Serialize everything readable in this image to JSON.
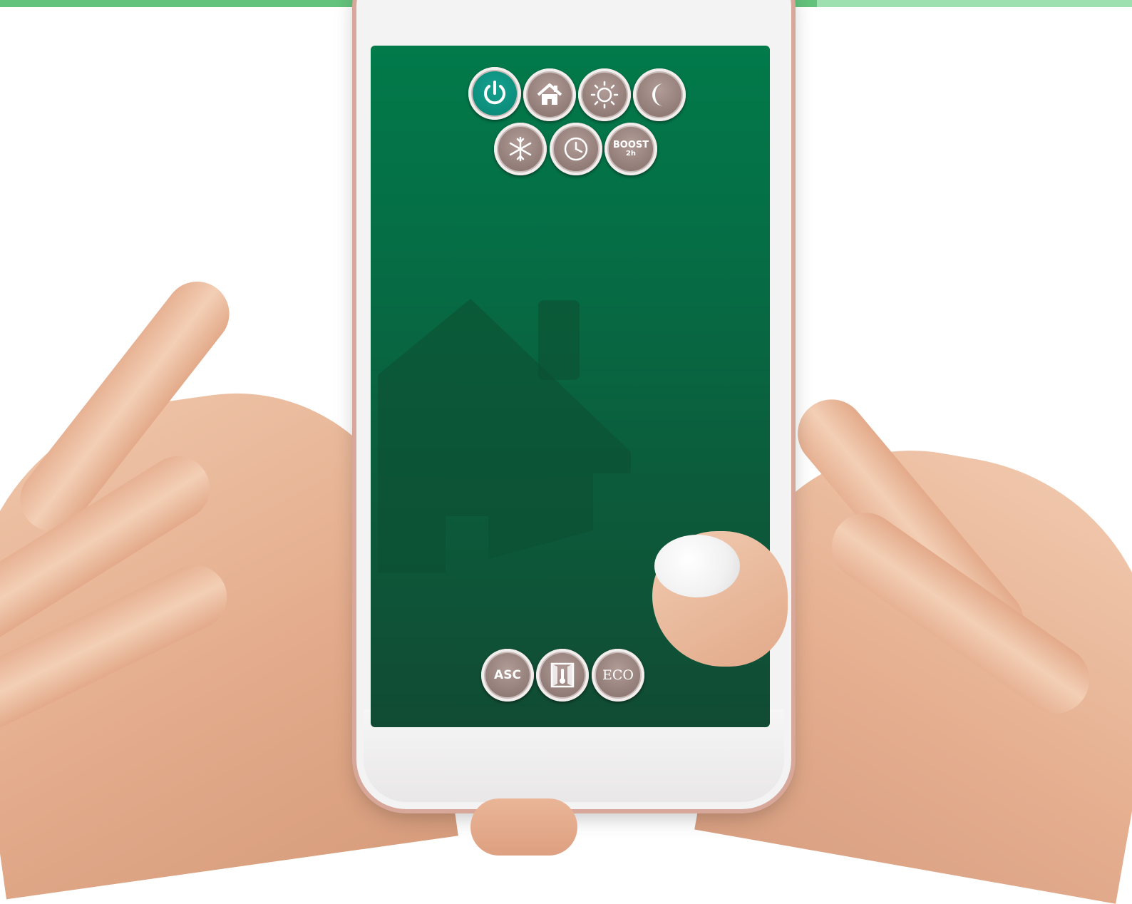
{
  "colors": {
    "accent_bar": "#63c27c",
    "accent_bar_light": "#9fe0b0",
    "screen_green": "#027a4a",
    "active_button": "#0d8a79",
    "button_neutral": "#8d7772"
  },
  "app": {
    "top_buttons": [
      {
        "name": "power",
        "icon": "power-icon",
        "active": true
      },
      {
        "name": "home",
        "icon": "home-icon",
        "active": false
      },
      {
        "name": "sun",
        "icon": "sun-icon",
        "active": false
      },
      {
        "name": "moon",
        "icon": "moon-icon",
        "active": false
      }
    ],
    "second_row_buttons": [
      {
        "name": "frost",
        "icon": "snowflake-icon"
      },
      {
        "name": "timer",
        "icon": "clock-icon"
      },
      {
        "name": "boost",
        "label": "BOOST",
        "sublabel": "2h"
      }
    ],
    "bottom_buttons": [
      {
        "name": "asc",
        "label": "ASC"
      },
      {
        "name": "window",
        "icon": "window-thermometer-icon"
      },
      {
        "name": "eco",
        "label": "ECO"
      }
    ],
    "background_icon": "house-icon"
  }
}
